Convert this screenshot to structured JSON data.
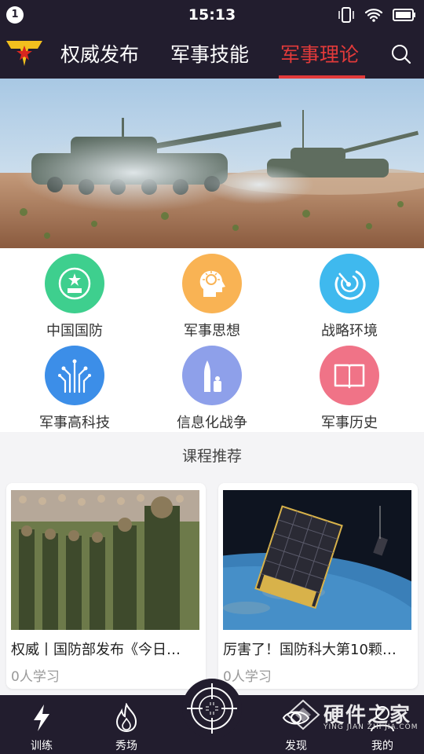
{
  "status": {
    "notification_count": "1",
    "time": "15:13"
  },
  "nav": {
    "tabs": [
      {
        "label": "权威发布"
      },
      {
        "label": "军事技能"
      },
      {
        "label": "军事理论"
      }
    ],
    "active_tab": "军事理论"
  },
  "categories": [
    {
      "label": "中国国防",
      "icon": "national-emblem-icon",
      "color": "#3ecf8e"
    },
    {
      "label": "军事思想",
      "icon": "brain-head-icon",
      "color": "#f9b354"
    },
    {
      "label": "战略环境",
      "icon": "radar-icon",
      "color": "#3fb9ee"
    },
    {
      "label": "军事高科技",
      "icon": "circuit-tree-icon",
      "color": "#3c8ee8"
    },
    {
      "label": "信息化战争",
      "icon": "missile-icon",
      "color": "#8ea0ea"
    },
    {
      "label": "军事历史",
      "icon": "book-icon",
      "color": "#f07387"
    }
  ],
  "recommend": {
    "title": "课程推荐",
    "cards": [
      {
        "title": "权威丨国防部发布《今日…",
        "meta": "0人学习"
      },
      {
        "title": "厉害了！国防科大第10颗…",
        "meta": "0人学习"
      }
    ]
  },
  "bottom_nav": [
    {
      "label": "训练",
      "icon": "lightning-icon"
    },
    {
      "label": "秀场",
      "icon": "flame-icon"
    },
    {
      "label": "发现",
      "icon": "eye-icon"
    },
    {
      "label": "我的",
      "icon": "user-icon"
    }
  ],
  "watermark": {
    "text": "硬件之家",
    "sub": "YING JIAN ZHI JIA.COM"
  },
  "colors": {
    "bar": "#221d2e",
    "accent": "#e23a3a"
  }
}
